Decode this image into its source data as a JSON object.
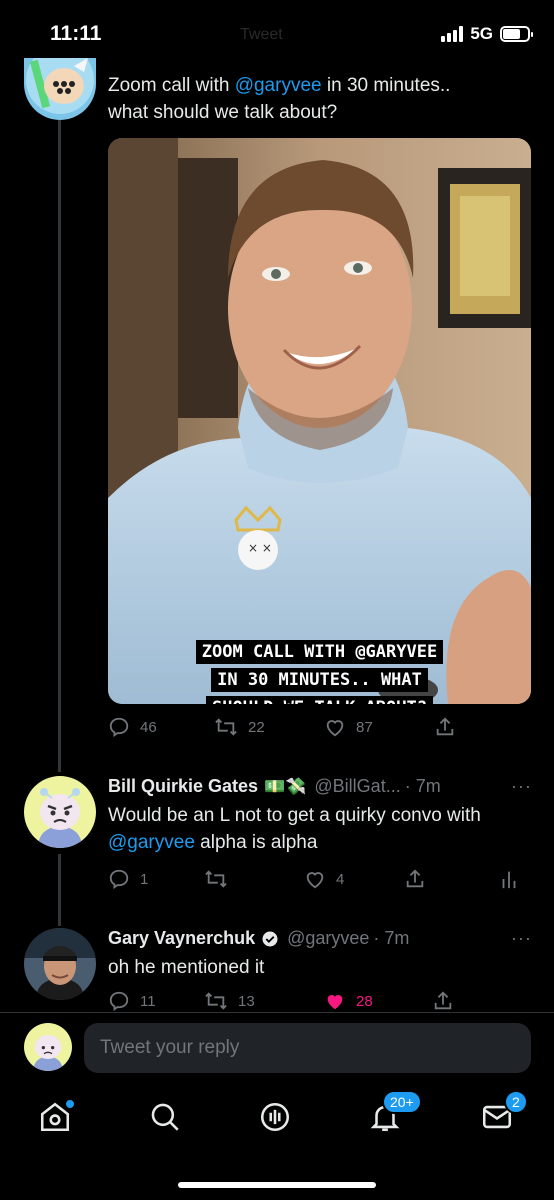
{
  "status_bar": {
    "time": "11:11",
    "network": "5G",
    "faded_title": "Tweet"
  },
  "tweets": [
    {
      "text_prefix": "Zoom call with ",
      "mention": "@garyvee",
      "text_suffix_line1": " in 30 minutes..",
      "text_line2": "what should we talk about?",
      "media_caption": [
        "ZOOM CALL WITH @GARYVEE",
        "IN 30 MINUTES.. WHAT",
        "SHOULD WE TALK ABOUT?"
      ],
      "replies": "46",
      "retweets": "22",
      "likes": "87"
    },
    {
      "name": "Bill Quirkie Gates",
      "emoji": "💵💸",
      "handle": "@BillGat...",
      "time": "· 7m",
      "text_line1": "Would be an L not to get a quirky convo with",
      "mention": "@garyvee",
      "text_after_mention": " alpha is alpha",
      "replies": "1",
      "retweets": "",
      "likes": "4"
    },
    {
      "name": "Gary Vaynerchuk",
      "handle": "@garyvee",
      "time": "· 7m",
      "text": "oh he mentioned it",
      "replies": "11",
      "retweets": "13",
      "likes": "28"
    }
  ],
  "reply_bar": {
    "placeholder": "Tweet your reply"
  },
  "nav": {
    "notifications_badge": "20+",
    "messages_badge": "2"
  },
  "colors": {
    "accent": "#1d9bf0",
    "like_active": "#f91880",
    "muted": "#71767b"
  },
  "more_label": "···"
}
